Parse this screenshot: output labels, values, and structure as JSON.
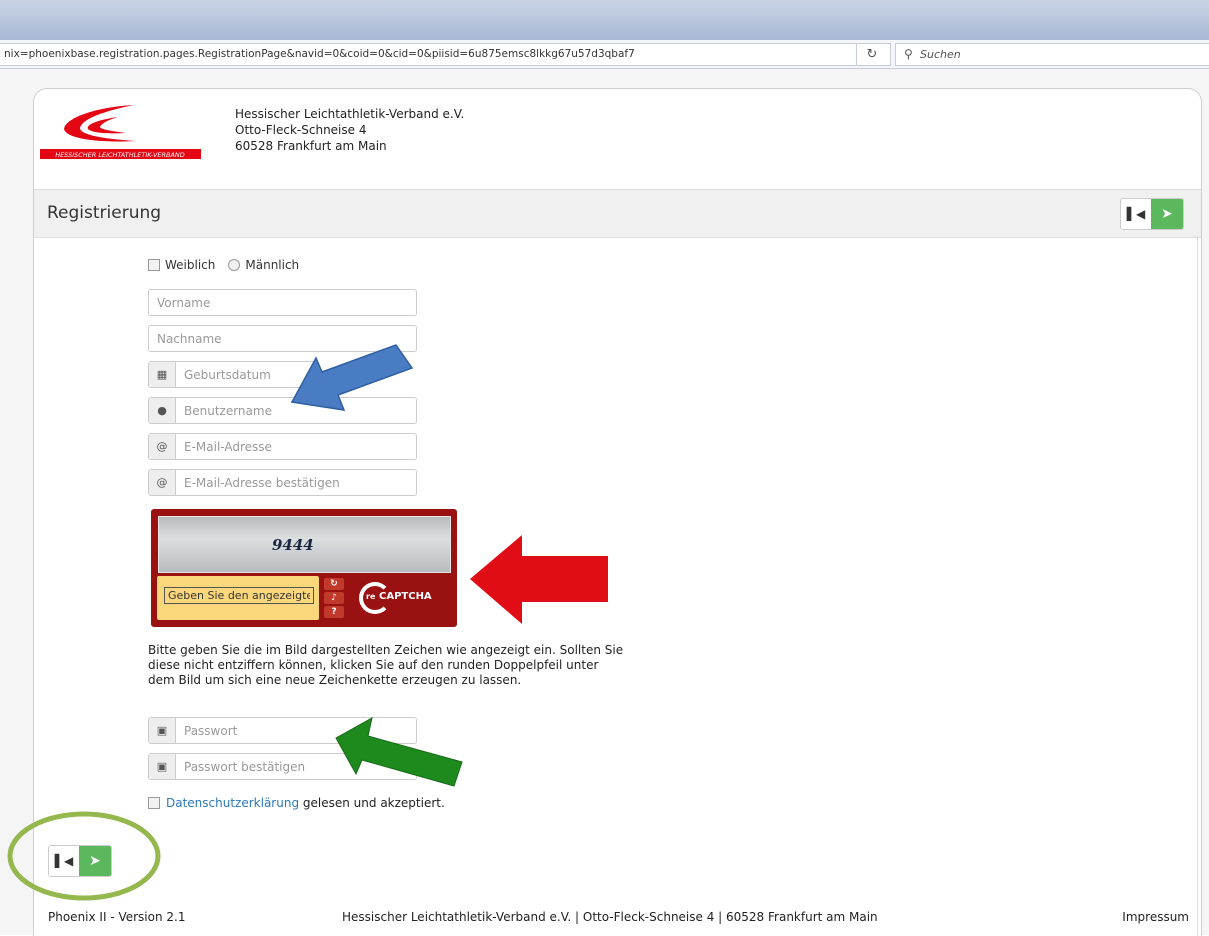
{
  "browser": {
    "url": "nix=phoenixbase.registration.pages.RegistrationPage&navid=0&coid=0&cid=0&piisid=6u875emsc8lkkg67u57d3qbaf7",
    "search_placeholder": "Suchen"
  },
  "header": {
    "logo_text": "HESSISCHER LEICHTATHLETIK-VERBAND",
    "org_name": "Hessischer Leichtathletik-Verband e.V.",
    "street": "Otto-Fleck-Schneise 4",
    "city": "60528 Frankfurt am Main"
  },
  "page_title": "Registrierung",
  "form": {
    "gender_female": "Weiblich",
    "gender_male": "Männlich",
    "first_name_placeholder": "Vorname",
    "last_name_placeholder": "Nachname",
    "birthdate_placeholder": "Geburtsdatum",
    "username_placeholder": "Benutzername",
    "email_placeholder": "E-Mail-Adresse",
    "email_confirm_placeholder": "E-Mail-Adresse bestätigen",
    "captcha_text": "9444",
    "captcha_input_value": "Geben Sie den angezeigte",
    "captcha_brand": "CAPTCHA",
    "captcha_re": "re",
    "captcha_help": "Bitte geben Sie die im Bild dargestellten Zeichen wie angezeigt ein. Sollten Sie diese nicht entziffern können, klicken Sie auf den runden Doppelpfeil unter dem Bild um sich eine neue Zeichenkette erzeugen zu lassen.",
    "password_placeholder": "Passwort",
    "password_confirm_placeholder": "Passwort bestätigen",
    "privacy_link": "Datenschutzerklärung",
    "privacy_suffix": "gelesen und akzeptiert."
  },
  "footer": {
    "version": "Phoenix II - Version 2.1",
    "address": "Hessischer Leichtathletik-Verband e.V. | Otto-Fleck-Schneise 4 | 60528 Frankfurt am Main",
    "imprint": "Impressum"
  },
  "colors": {
    "accent_green": "#5cb85c",
    "annotation_blue": "#4a7cc4",
    "annotation_red": "#e00d17",
    "annotation_green": "#1e8a1e",
    "annotation_circle": "#94b84d"
  }
}
